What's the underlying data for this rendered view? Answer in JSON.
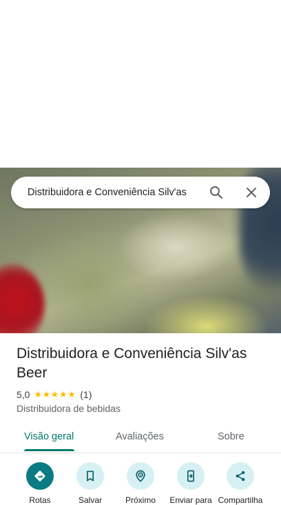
{
  "search": {
    "query": "Distribuidora e Conveniência Silv'as"
  },
  "place": {
    "name": "Distribuidora e Conveniência Silv'as Beer",
    "rating": "5,0",
    "stars": "★★★★★",
    "review_count": "(1)",
    "category": "Distribuidora de bebidas"
  },
  "tabs": [
    {
      "label": "Visão geral",
      "active": true
    },
    {
      "label": "Avaliações",
      "active": false
    },
    {
      "label": "Sobre",
      "active": false
    }
  ],
  "actions": [
    {
      "label": "Rotas",
      "icon": "directions-icon"
    },
    {
      "label": "Salvar",
      "icon": "bookmark-icon"
    },
    {
      "label": "Próximo",
      "icon": "nearby-icon"
    },
    {
      "label": "Enviar para",
      "icon": "send-to-phone-icon"
    },
    {
      "label": "Compartilha",
      "icon": "share-icon"
    }
  ],
  "colors": {
    "accent": "#00796b",
    "action_bg": "#d6f0f3",
    "primary_action_bg": "#0b7a82",
    "star": "#fbbc04"
  }
}
